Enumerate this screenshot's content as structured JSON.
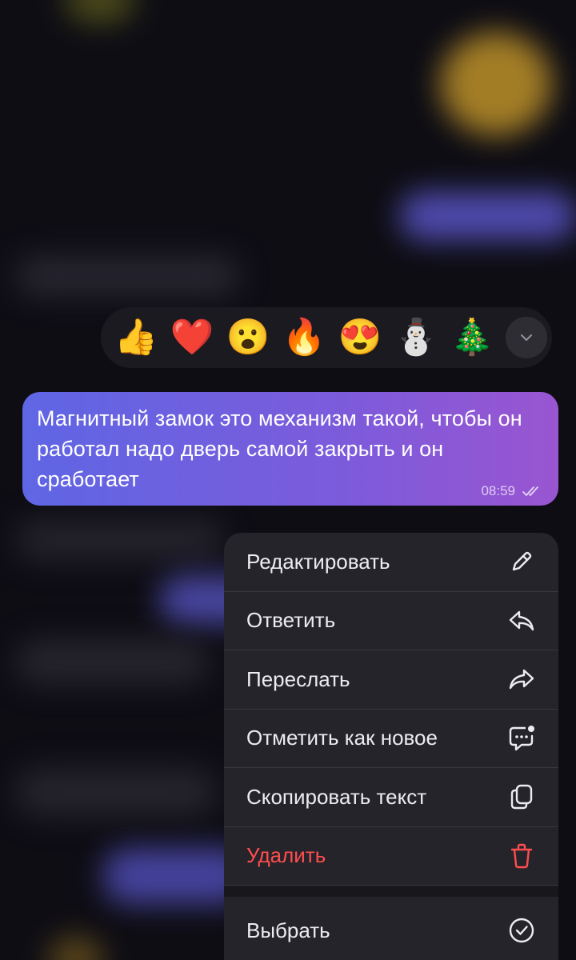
{
  "reactions": {
    "emojis": [
      "👍",
      "❤️",
      "😮",
      "🔥",
      "😍",
      "⛄",
      "🎄"
    ],
    "expand_icon": "chevron-down-icon"
  },
  "message": {
    "text": "Магнитный замок это механизм такой, чтобы он работал надо дверь самой закрыть и он сработает",
    "time": "08:59",
    "status_icon": "double-check-icon"
  },
  "context_menu": {
    "items": [
      {
        "label": "Редактировать",
        "icon": "pencil-icon"
      },
      {
        "label": "Ответить",
        "icon": "reply-icon"
      },
      {
        "label": "Переслать",
        "icon": "forward-icon"
      },
      {
        "label": "Отметить как новое",
        "icon": "mark-unread-icon"
      },
      {
        "label": "Скопировать текст",
        "icon": "copy-icon"
      },
      {
        "label": "Удалить",
        "icon": "trash-icon",
        "color": "#ff4d4d"
      },
      {
        "label": "Выбрать",
        "icon": "check-circle-icon"
      }
    ]
  }
}
